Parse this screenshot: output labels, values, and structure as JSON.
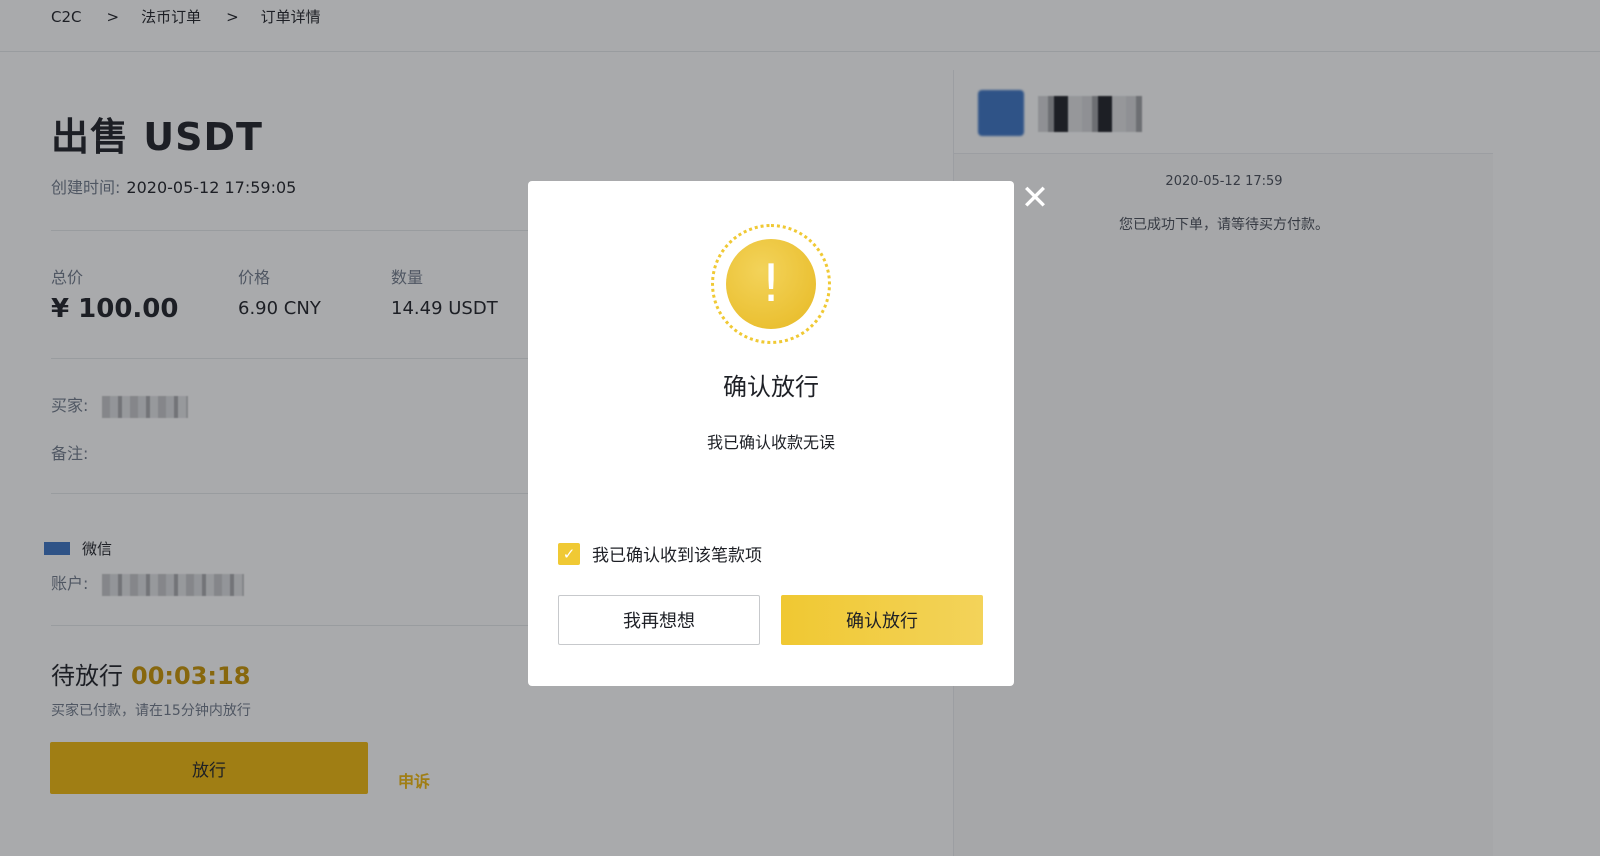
{
  "breadcrumb": {
    "items": [
      "C2C",
      "法币订单",
      "订单详情"
    ],
    "separator": ">"
  },
  "order": {
    "title": "出售 USDT",
    "created_label": "创建时间:",
    "created_value": "2020-05-12 17:59:05",
    "total_label": "总价",
    "total_value": "¥ 100.00",
    "price_label": "价格",
    "price_value": "6.90 CNY",
    "quantity_label": "数量",
    "quantity_value": "14.49 USDT",
    "buyer_label": "买家:",
    "note_label": "备注:",
    "payment_method_label": "微信",
    "account_label": "账户:",
    "status_label": "待放行",
    "countdown": "00:03:18",
    "status_note": "买家已付款，请在15分钟内放行",
    "release_button": "放行",
    "appeal_link": "申诉"
  },
  "chat": {
    "timestamp": "2020-05-12 17:59",
    "message": "您已成功下单，请等待买方付款。"
  },
  "modal": {
    "close_icon": "close-icon",
    "warning_icon": "exclamation-icon",
    "warning_glyph": "!",
    "title": "确认放行",
    "description": "我已确认收款无误",
    "checkbox_label": "我已确认收到该笔款项",
    "checkbox_checked": true,
    "cancel_button": "我再想想",
    "confirm_button": "确认放行"
  },
  "colors": {
    "accent": "#f0b90b",
    "accent_light": "#f0c934",
    "text_primary": "#1e2026",
    "text_secondary": "#707a8a"
  }
}
